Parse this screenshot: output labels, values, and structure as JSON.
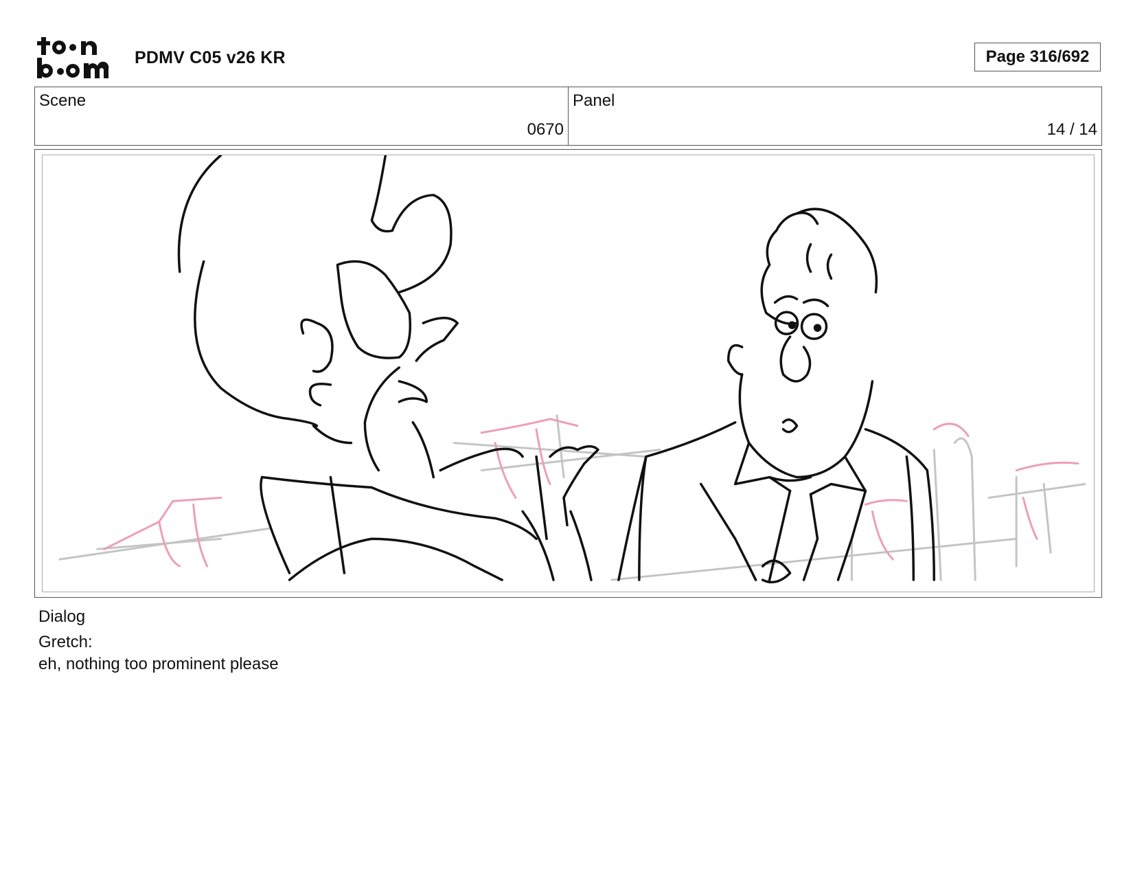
{
  "header": {
    "logo_text_top": "toon",
    "logo_text_bottom": "boom",
    "project_title": "PDMV C05 v26 KR",
    "page_label": "Page 316/692"
  },
  "info": {
    "scene_label": "Scene",
    "scene_value": "0670",
    "panel_label": "Panel",
    "panel_value": "14 / 14"
  },
  "dialog": {
    "label": "Dialog",
    "speaker": "Gretch:",
    "line": "eh, nothing too prominent please"
  },
  "colors": {
    "sketch_line": "#111111",
    "rough_pink": "#e8a0b4",
    "rough_gray": "#b8b8b8"
  }
}
